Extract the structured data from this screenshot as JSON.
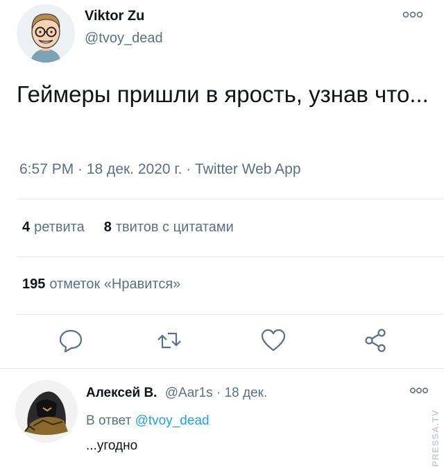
{
  "tweet": {
    "author_name": "Viktor Zu",
    "author_handle": "@tvoy_dead",
    "text": "Геймеры пришли в ярость, узнав что...",
    "meta": "6:57 PM · 18 дек. 2020 г. · Twitter Web App",
    "stats": {
      "retweets_count": "4",
      "retweets_label": "ретвита",
      "quotes_count": "8",
      "quotes_label": "твитов с цитатами",
      "likes_count": "195",
      "likes_label": "отметок «Нравится»"
    },
    "icons": [
      "reply-icon",
      "retweet-icon",
      "like-icon",
      "share-icon",
      "more-icon"
    ]
  },
  "reply": {
    "author_name": "Алексей В.",
    "author_handle": "@Aar1s",
    "separator": "·",
    "date": "18 дек.",
    "reply_to_label": "В ответ",
    "reply_to_handle": "@tvoy_dead",
    "text": "...угодно"
  },
  "watermark": "PRESSA.TV",
  "colors": {
    "text": "#0f1419",
    "secondary": "#5b7083",
    "link": "#1da1f2",
    "divider": "#e6ecf0"
  }
}
